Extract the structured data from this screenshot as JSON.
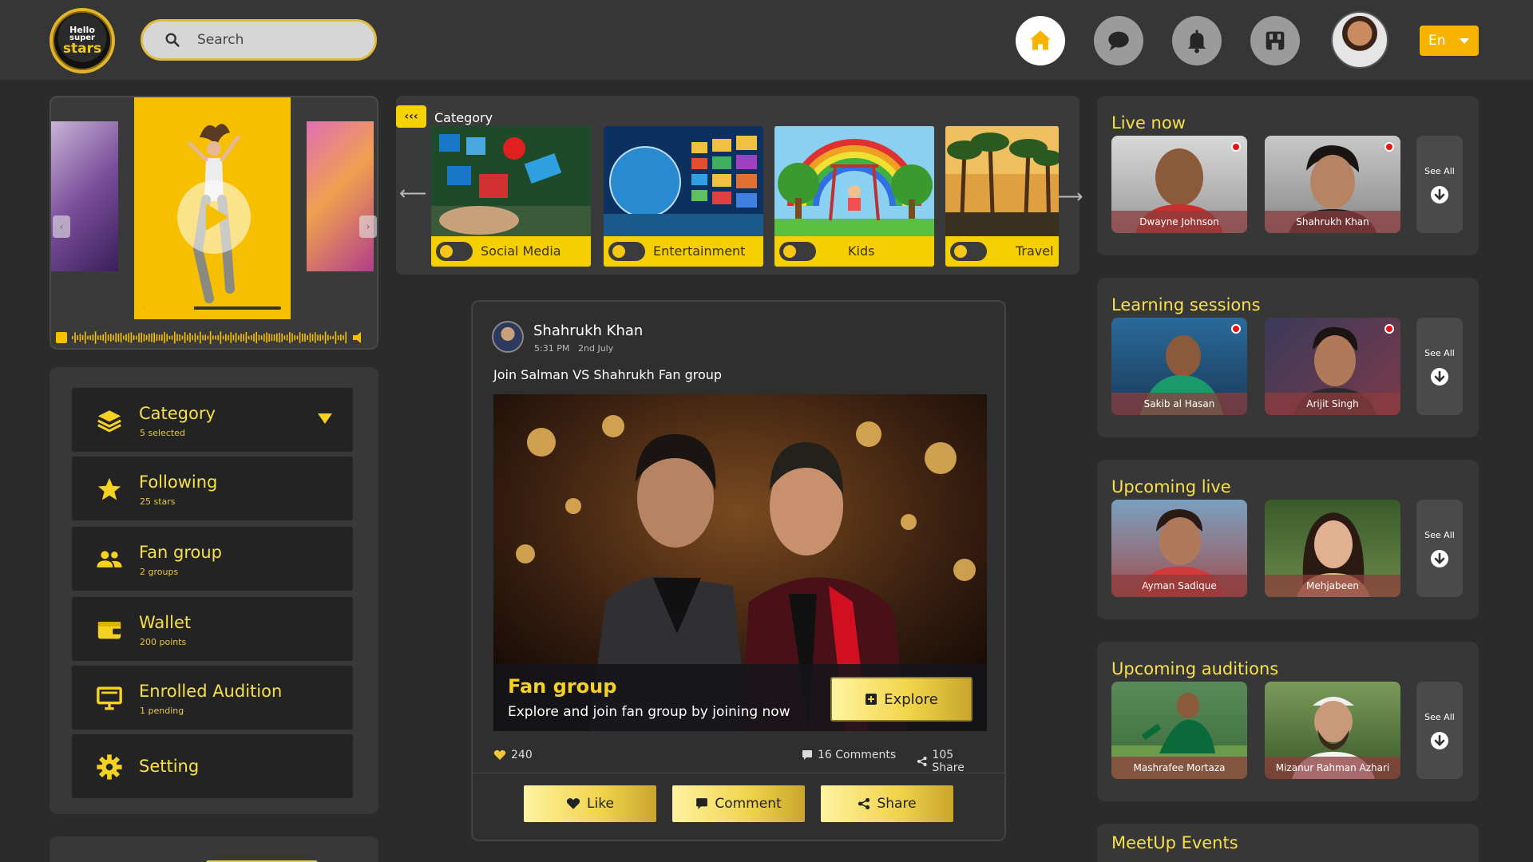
{
  "logo": {
    "line1": "Hello",
    "line2": "super",
    "line3": "stars"
  },
  "search": {
    "placeholder": "Search"
  },
  "language": {
    "selected": "En"
  },
  "colors": {
    "accent": "#f6c000",
    "background": "#2b2b2b",
    "panel": "#383838",
    "title_yellow": "#f7e04a"
  },
  "player": {
    "progress": 0.33
  },
  "menu": {
    "items": [
      {
        "title": "Category",
        "sub": "5 selected",
        "icon": "layers-icon"
      },
      {
        "title": "Following",
        "sub": "25 stars",
        "icon": "star-icon"
      },
      {
        "title": "Fan group",
        "sub": "2 groups",
        "icon": "people-icon"
      },
      {
        "title": "Wallet",
        "sub": "200 points",
        "icon": "wallet-icon"
      },
      {
        "title": "Enrolled Audition",
        "sub": "1 pending",
        "icon": "presentation-icon"
      },
      {
        "title": "Setting",
        "sub": "",
        "icon": "gear-icon"
      }
    ]
  },
  "categories": {
    "label": "Category",
    "items": [
      {
        "name": "Social Media"
      },
      {
        "name": "Entertainment"
      },
      {
        "name": "Kids"
      },
      {
        "name": "Travel"
      }
    ]
  },
  "post": {
    "author": "Shahrukh Khan",
    "time": "5:31 PM",
    "date": "2nd July",
    "text": "Join Salman VS Shahrukh Fan group",
    "overlay_title": "Fan group",
    "overlay_sub": "Explore and join fan group by joining now",
    "explore_label": "Explore",
    "likes": "240",
    "comments": "16 Comments",
    "shares": "105 Share",
    "like_label": "Like",
    "comment_label": "Comment",
    "share_label": "Share"
  },
  "right": {
    "see_all": "See All",
    "live_now": {
      "title": "Live now",
      "people": [
        "Dwayne Johnson",
        "Shahrukh Khan"
      ]
    },
    "learning": {
      "title": "Learning sessions",
      "people": [
        "Sakib al Hasan",
        "Arijit Singh"
      ]
    },
    "upcoming_live": {
      "title": "Upcoming live",
      "people": [
        "Ayman Sadique",
        "Mehjabeen"
      ]
    },
    "auditions": {
      "title": "Upcoming auditions",
      "people": [
        "Mashrafee Mortaza",
        "Mizanur Rahman Azhari"
      ]
    },
    "meetup": {
      "title": "MeetUp Events"
    }
  }
}
